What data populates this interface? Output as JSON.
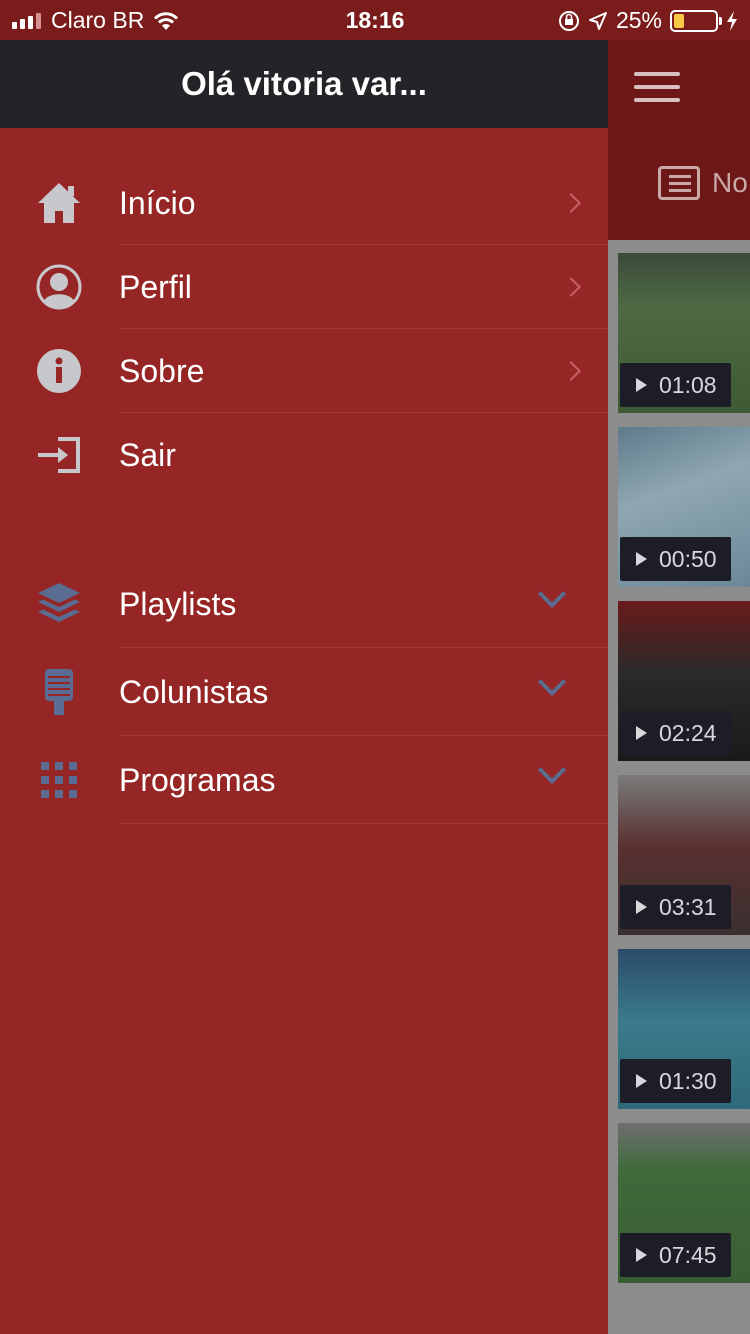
{
  "status_bar": {
    "carrier": "Claro BR",
    "time": "18:16",
    "battery_percent": "25%",
    "battery_level": 0.25,
    "battery_color": "#f7c945"
  },
  "drawer": {
    "greeting": "Olá vitoria var...",
    "account_items": [
      {
        "label": "Início",
        "icon": "home-icon"
      },
      {
        "label": "Perfil",
        "icon": "user-circle-icon"
      },
      {
        "label": "Sobre",
        "icon": "info-icon"
      },
      {
        "label": "Sair",
        "icon": "sign-out-icon"
      }
    ],
    "section_items": [
      {
        "label": "Playlists",
        "icon": "layers-icon"
      },
      {
        "label": "Colunistas",
        "icon": "microphone-icon"
      },
      {
        "label": "Programas",
        "icon": "grid-icon"
      }
    ]
  },
  "background": {
    "menu_icon": "hamburger-icon",
    "tab_label": "No",
    "tab_icon": "newspaper-icon",
    "videos": [
      {
        "duration": "01:08"
      },
      {
        "duration": "00:50"
      },
      {
        "duration": "02:24"
      },
      {
        "duration": "03:31"
      },
      {
        "duration": "01:30"
      },
      {
        "duration": "07:45"
      }
    ]
  },
  "colors": {
    "drawer_bg": "#962626",
    "drawer_header_bg": "#232428",
    "status_bar_bg": "#7a1c1c",
    "section_icon_color": "#5a6c92"
  }
}
